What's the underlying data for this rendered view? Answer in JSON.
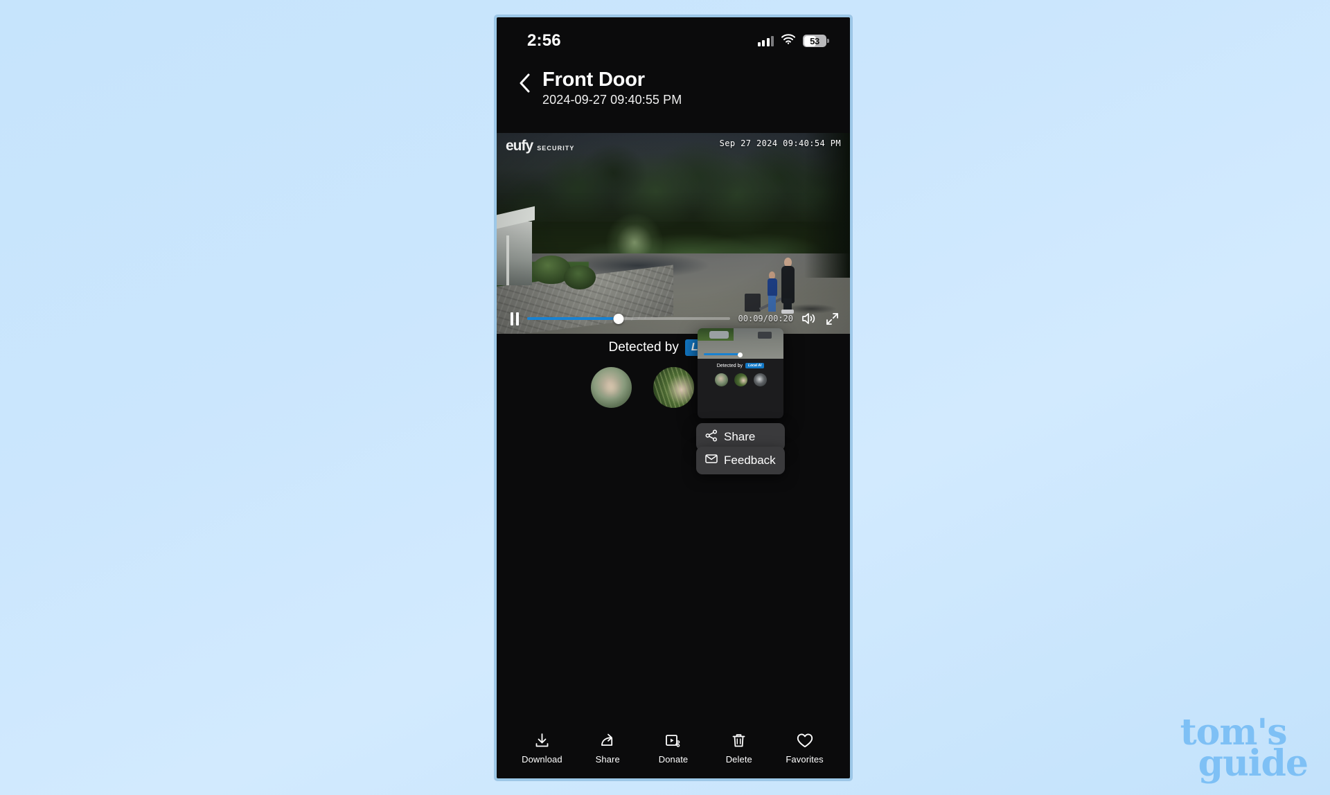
{
  "background": {
    "accent": "#7ec0f5",
    "frame_color": "#9cc8e8"
  },
  "status_bar": {
    "time": "2:56",
    "signal_icon": "cellular-signal-icon",
    "wifi_icon": "wifi-icon",
    "battery_level": "53"
  },
  "header": {
    "back_icon": "chevron-left-icon",
    "title": "Front Door",
    "subtitle": "2024-09-27 09:40:55 PM"
  },
  "video": {
    "watermark_brand": "eufy",
    "watermark_sub": "SECURITY",
    "timestamp_overlay": "Sep 27 2024   09:40:54 PM",
    "controls": {
      "play_state_icon": "pause-icon",
      "time_label": "00:09/00:20",
      "progress_percent": 45,
      "volume_icon": "volume-icon",
      "fullscreen_icon": "fullscreen-expand-icon",
      "accent": "#1982d1"
    }
  },
  "detection": {
    "label": "Detected by",
    "badge": "Local A",
    "badge_color": "#1277c4",
    "thumbnails": [
      "face-thumbnail-1",
      "face-thumbnail-2",
      "face-thumbnail-3"
    ]
  },
  "context_menu": {
    "items": [
      {
        "label": "Share",
        "icon": "share-nodes-icon"
      },
      {
        "label": "Feedback",
        "icon": "envelope-icon"
      }
    ]
  },
  "preview_card": {
    "detected_label": "Detected by",
    "badge": "Local AI"
  },
  "toolbar": {
    "items": [
      {
        "label": "Download",
        "icon": "download-icon"
      },
      {
        "label": "Share",
        "icon": "share-arrow-icon"
      },
      {
        "label": "Donate",
        "icon": "video-share-icon"
      },
      {
        "label": "Delete",
        "icon": "trash-icon"
      },
      {
        "label": "Favorites",
        "icon": "heart-icon"
      }
    ]
  },
  "watermark": {
    "line1": "tom's",
    "line2": "guide"
  }
}
